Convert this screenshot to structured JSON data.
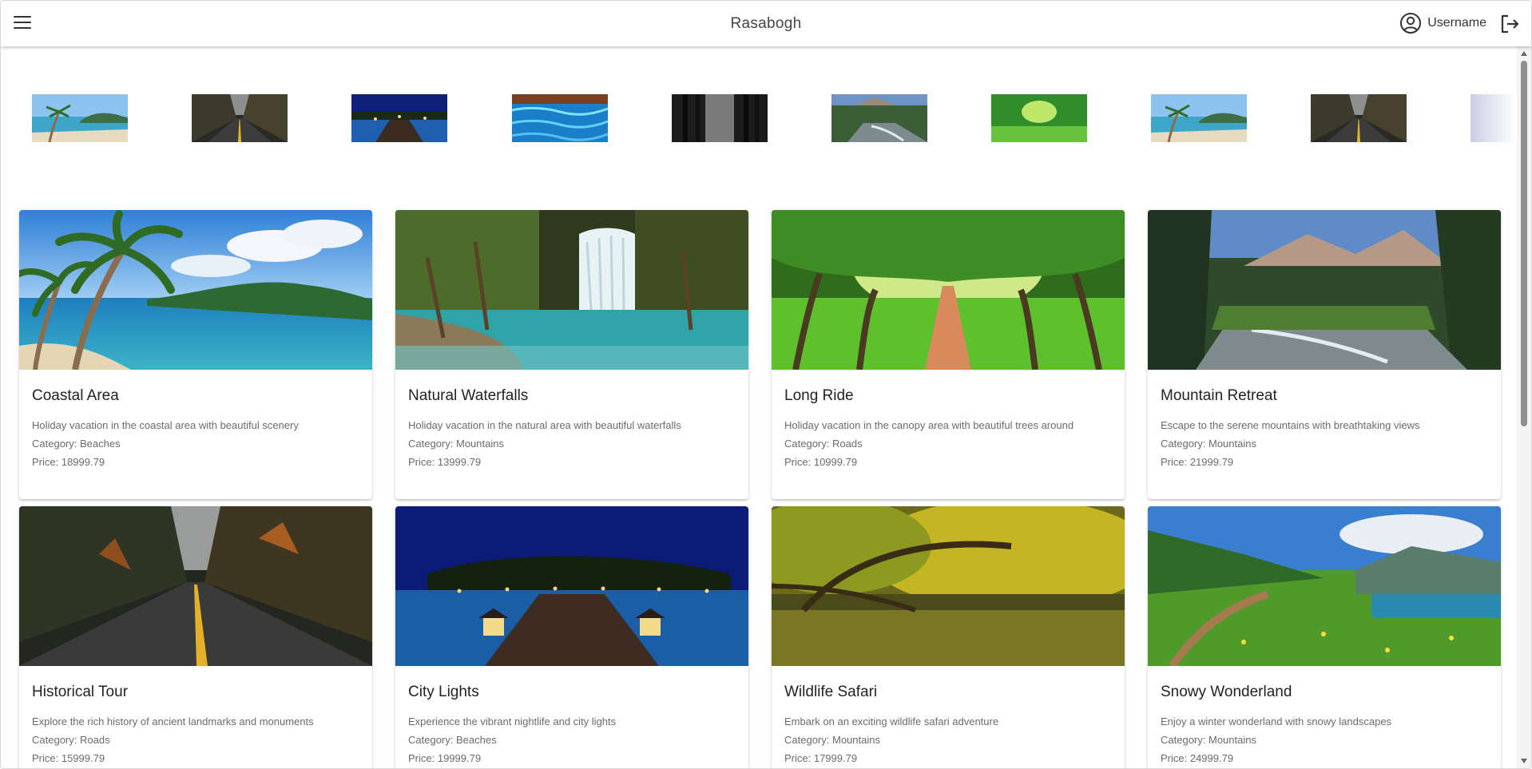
{
  "header": {
    "title": "Rasabogh",
    "username": "Username",
    "icons": {
      "menu": "hamburger-menu-icon",
      "user": "account-circle-icon",
      "logout": "logout-icon"
    }
  },
  "carousel": {
    "thumbnails": [
      {
        "scene": "beach-palms"
      },
      {
        "scene": "forest-road"
      },
      {
        "scene": "night-pier"
      },
      {
        "scene": "blue-water"
      },
      {
        "scene": "dark-forest"
      },
      {
        "scene": "mountain-river"
      },
      {
        "scene": "green-tree-tunnel"
      },
      {
        "scene": "beach-palms"
      },
      {
        "scene": "forest-road"
      },
      {
        "scene": "faded-partial"
      }
    ]
  },
  "labels": {
    "category": "Category: ",
    "price": "Price: "
  },
  "destinations": [
    {
      "title": "Coastal Area",
      "description": "Holiday vacation in the coastal area with beautiful scenery",
      "category": "Beaches",
      "price": "18999.79"
    },
    {
      "title": "Natural Waterfalls",
      "description": "Holiday vacation in the natural area with beautiful waterfalls",
      "category": "Mountains",
      "price": "13999.79"
    },
    {
      "title": "Long Ride",
      "description": "Holiday vacation in the canopy area with beautiful trees around",
      "category": "Roads",
      "price": "10999.79"
    },
    {
      "title": "Mountain Retreat",
      "description": "Escape to the serene mountains with breathtaking views",
      "category": "Mountains",
      "price": "21999.79"
    },
    {
      "title": "Historical Tour",
      "description": "Explore the rich history of ancient landmarks and monuments",
      "category": "Roads",
      "price": "15999.79"
    },
    {
      "title": "City Lights",
      "description": "Experience the vibrant nightlife and city lights",
      "category": "Beaches",
      "price": "19999.79"
    },
    {
      "title": "Wildlife Safari",
      "description": "Embark on an exciting wildlife safari adventure",
      "category": "Mountains",
      "price": "17999.79"
    },
    {
      "title": "Snowy Wonderland",
      "description": "Enjoy a winter wonderland with snowy landscapes",
      "category": "Mountains",
      "price": "24999.79"
    }
  ]
}
